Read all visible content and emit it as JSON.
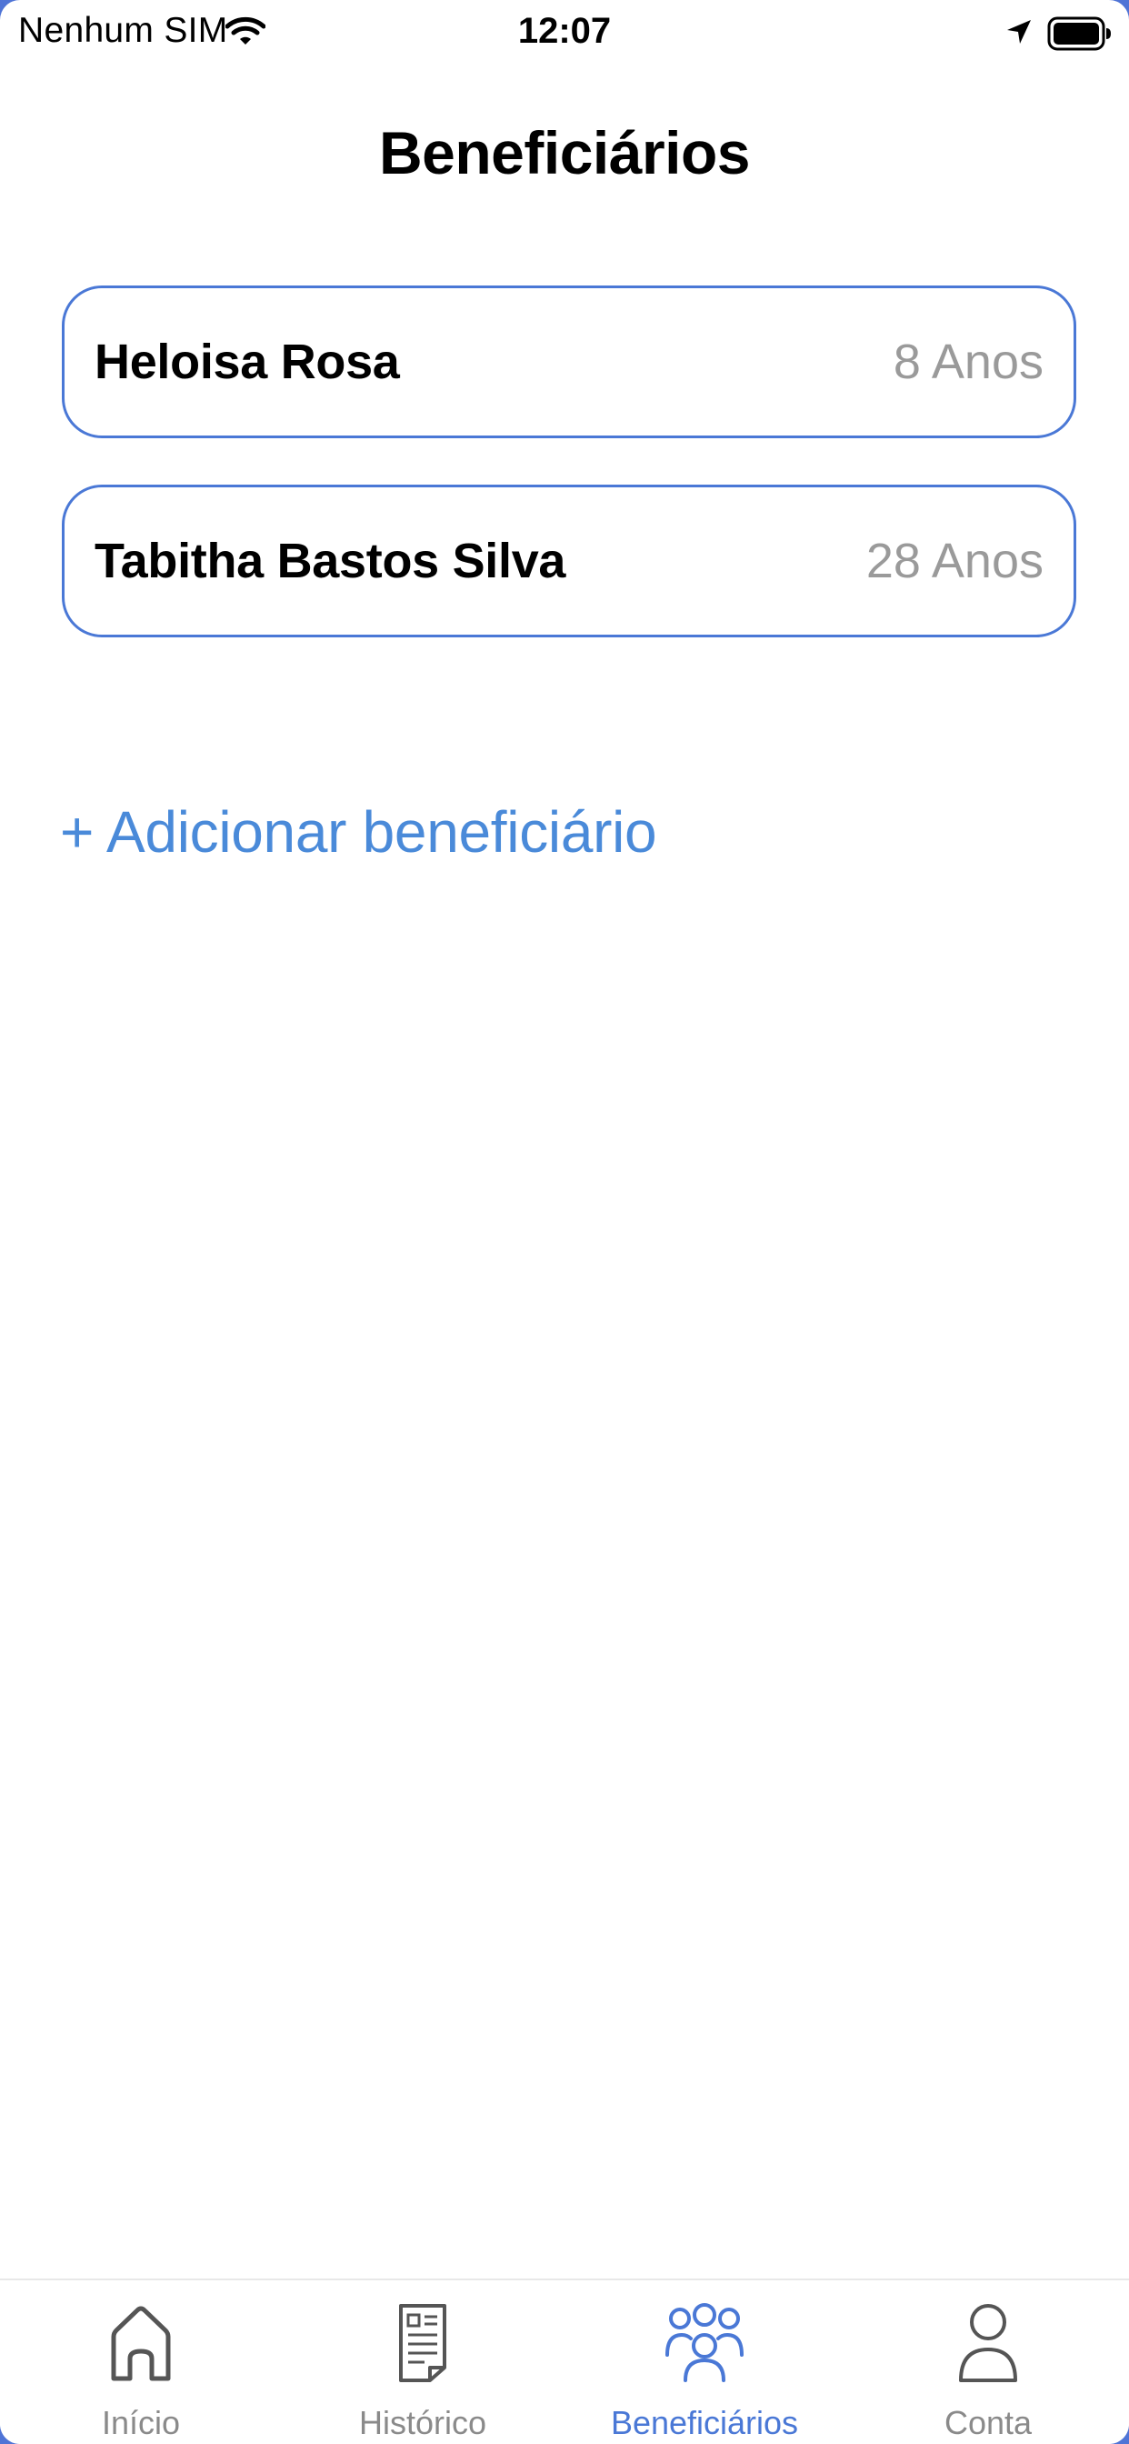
{
  "status_bar": {
    "carrier": "Nenhum SIM",
    "time": "12:07"
  },
  "page": {
    "title": "Beneficiários"
  },
  "beneficiaries": [
    {
      "name": "Heloisa Rosa",
      "age": "8 Anos"
    },
    {
      "name": "Tabitha Bastos Silva",
      "age": "28 Anos"
    }
  ],
  "actions": {
    "add_beneficiary": "+ Adicionar beneficiário"
  },
  "tab_bar": {
    "tabs": [
      {
        "label": "Início",
        "icon": "home-icon"
      },
      {
        "label": "Histórico",
        "icon": "document-icon"
      },
      {
        "label": "Beneficiários",
        "icon": "group-icon",
        "active": true
      },
      {
        "label": "Conta",
        "icon": "user-icon"
      }
    ]
  },
  "colors": {
    "accent": "#4a78d6",
    "link": "#4a8ad9",
    "muted": "#9a9a9a",
    "inactive_tab": "#8a8a8a"
  }
}
